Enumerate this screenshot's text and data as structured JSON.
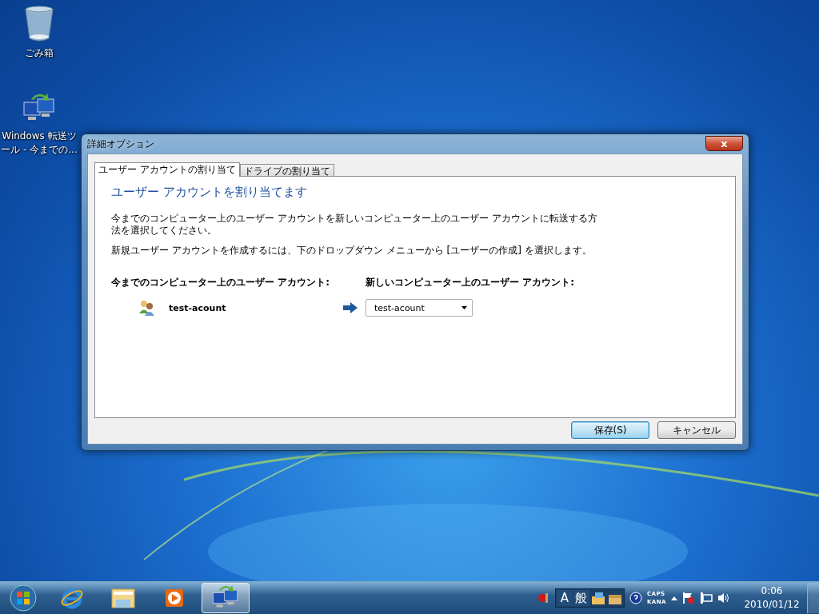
{
  "desktop_icons": [
    {
      "kind": "trash",
      "label": "ごみ箱"
    },
    {
      "kind": "transfer",
      "label": "Windows 転送ツール - 今までの..."
    }
  ],
  "window": {
    "title": "詳細オプション",
    "close_symbol": "x",
    "tabs": [
      {
        "label": "ユーザー アカウントの割り当て",
        "selected": true
      },
      {
        "label": "ドライブの割り当て",
        "selected": false
      }
    ],
    "heading": "ユーザー アカウントを割り当てます",
    "paragraphs": [
      "今までのコンピューター上のユーザー アカウントを新しいコンピューター上のユーザー アカウントに転送する方法を選択してください。",
      "新規ユーザー アカウントを作成するには、下のドロップダウン メニューから [ユーザーの作成] を選択します。"
    ],
    "old_column_label": "今までのコンピューター上のユーザー アカウント:",
    "new_column_label": "新しいコンピューター上のユーザー アカウント:",
    "mappings": [
      {
        "old_account": "test-acount",
        "new_account": "test-acount"
      }
    ],
    "buttons": [
      {
        "label": "保存(S)",
        "default": true
      },
      {
        "label": "キャンセル",
        "default": false
      }
    ]
  },
  "taskbar": {
    "items": [
      {
        "kind": "start",
        "active": false
      },
      {
        "kind": "browser",
        "active": false
      },
      {
        "kind": "folder",
        "active": false
      },
      {
        "kind": "media",
        "active": false
      },
      {
        "kind": "transfer",
        "active": true
      }
    ],
    "ime": {
      "mode": "A",
      "input": "般"
    },
    "caps": "CAPS",
    "kana": "KANA",
    "time": "0:06",
    "date": "2010/01/12"
  }
}
